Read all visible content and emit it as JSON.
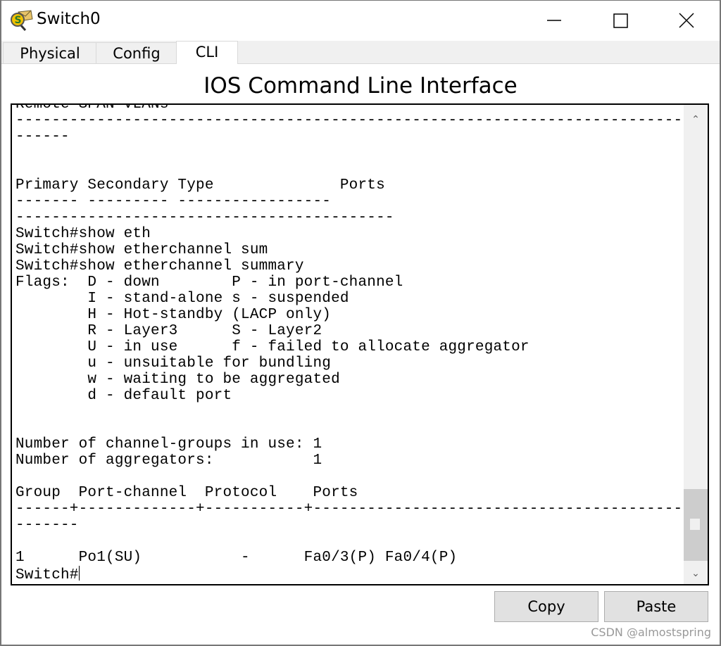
{
  "window": {
    "title": "Switch0",
    "icon": "switch-device-icon"
  },
  "tabs": [
    {
      "label": "Physical"
    },
    {
      "label": "Config"
    },
    {
      "label": "CLI",
      "active": true
    }
  ],
  "heading": "IOS Command Line Interface",
  "terminal": {
    "lines": [
      "Remote SPAN VLANs",
      "--------------------------------------------------------------------------",
      "------",
      "",
      "",
      "Primary Secondary Type              Ports",
      "------- --------- -----------------",
      "------------------------------------------",
      "Switch#show eth",
      "Switch#show etherchannel sum",
      "Switch#show etherchannel summary",
      "Flags:  D - down        P - in port-channel",
      "        I - stand-alone s - suspended",
      "        H - Hot-standby (LACP only)",
      "        R - Layer3      S - Layer2",
      "        U - in use      f - failed to allocate aggregator",
      "        u - unsuitable for bundling",
      "        w - waiting to be aggregated",
      "        d - default port",
      "",
      "",
      "Number of channel-groups in use: 1",
      "Number of aggregators:           1",
      "",
      "Group  Port-channel  Protocol    Ports",
      "------+-------------+-----------+-----------------------------------------",
      "-------",
      "",
      "1      Po1(SU)           -      Fa0/3(P) Fa0/4(P)"
    ],
    "prompt": "Switch#"
  },
  "buttons": {
    "copy": "Copy",
    "paste": "Paste"
  },
  "watermark": "CSDN @almostspring",
  "colors": {
    "tab_bar": "#f0f0f0",
    "button": "#e1e1e1",
    "scroll_thumb": "#cdcdcd"
  }
}
